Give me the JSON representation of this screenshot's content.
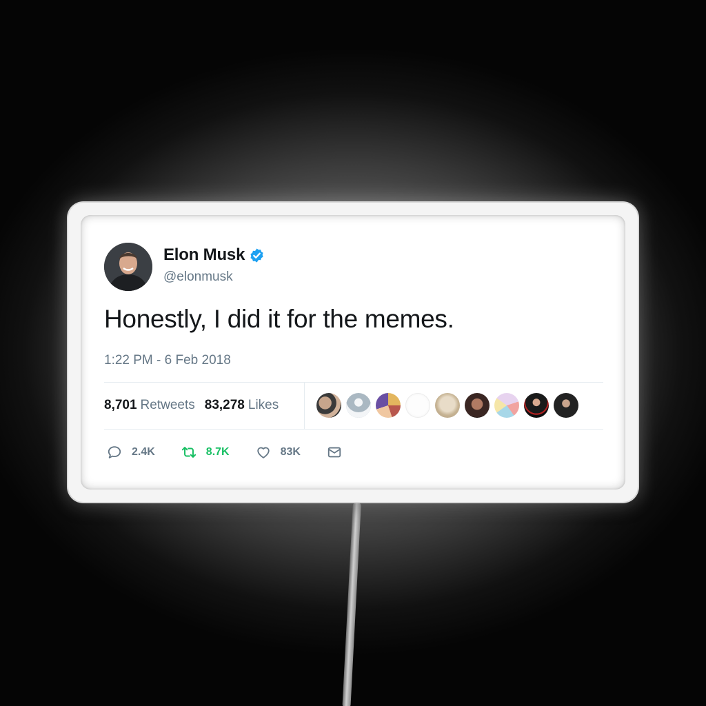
{
  "tweet": {
    "author_name": "Elon Musk",
    "handle": "@elonmusk",
    "verified": true,
    "text": "Honestly, I did it for the memes.",
    "timestamp": "1:22 PM - 6 Feb 2018",
    "retweets_count": "8,701",
    "retweets_label": "Retweets",
    "likes_count": "83,278",
    "likes_label": "Likes",
    "actions": {
      "reply_count": "2.4K",
      "retweet_count": "8.7K",
      "like_count": "83K"
    }
  },
  "icons": {
    "verified": "verified-badge-icon",
    "reply": "reply-icon",
    "retweet": "retweet-icon",
    "like": "heart-icon",
    "message": "envelope-icon"
  },
  "colors": {
    "verified_blue": "#1da1f2",
    "retweet_green": "#17bf63",
    "secondary_text": "#657786",
    "primary_text": "#14171a"
  }
}
